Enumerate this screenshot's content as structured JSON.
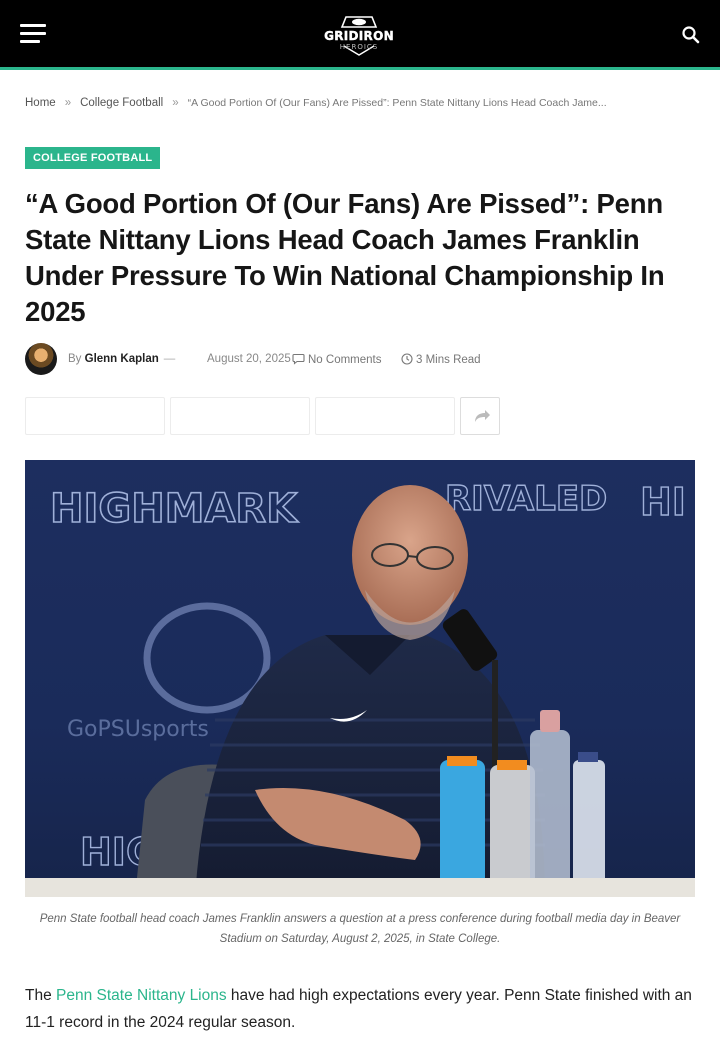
{
  "header": {
    "logo_word": "GRIDIRON",
    "logo_sub": "HEROICS",
    "accent_color": "#2bb58c"
  },
  "breadcrumb": {
    "home": "Home",
    "separator": "»",
    "category": "College Football",
    "current": "“A Good Portion Of (Our Fans) Are Pissed”: Penn State Nittany Lions Head Coach Jame..."
  },
  "article": {
    "category": "COLLEGE FOOTBALL",
    "title": "“A Good Portion Of (Our Fans) Are Pissed”: Penn State Nittany Lions Head Coach James Franklin Under Pressure To Win National Championship In 2025",
    "meta": {
      "by": "By",
      "author": "Glenn Kaplan",
      "dash": "—",
      "date": "August 20, 2025",
      "comments": "No Comments",
      "read_time": "3 Mins Read"
    },
    "hero": {
      "backdrop_words": [
        "HIGHMARK",
        "RIVALED",
        "GoPSUsports"
      ]
    },
    "caption": "Penn State football head coach James Franklin answers a question at a press conference during football media day in Beaver Stadium on Saturday, August 2, 2025, in State College.",
    "body": {
      "pre": "The ",
      "link": "Penn State Nittany Lions",
      "post": " have had high expectations every year. Penn State finished with an 11-1 record in the 2024 regular season."
    }
  }
}
